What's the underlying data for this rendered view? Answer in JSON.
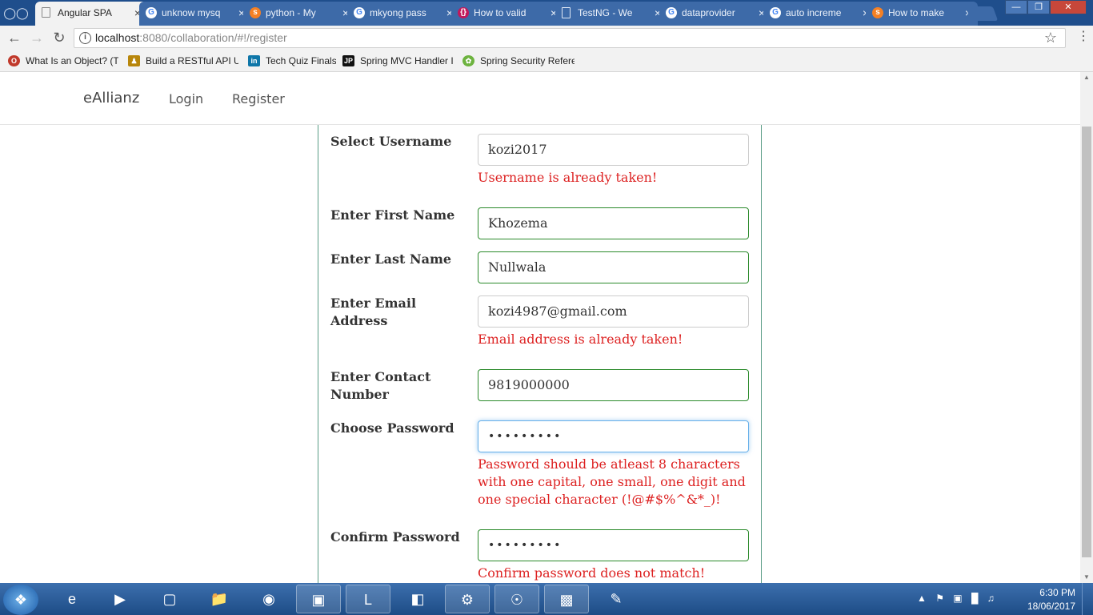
{
  "browser": {
    "tabs": [
      {
        "title": "Angular SPA",
        "favicon": "page-icon",
        "active": true
      },
      {
        "title": "unknow mysql",
        "favicon": "google-icon",
        "active": false
      },
      {
        "title": "python - My",
        "favicon": "stackoverflow-icon",
        "active": false
      },
      {
        "title": "mkyong pass",
        "favicon": "google-icon",
        "active": false
      },
      {
        "title": "How to valid",
        "favicon": "puzzle-icon",
        "active": false
      },
      {
        "title": "TestNG - We",
        "favicon": "page-icon",
        "active": false
      },
      {
        "title": "dataprovider",
        "favicon": "google-icon",
        "active": false
      },
      {
        "title": "auto increme",
        "favicon": "google-icon",
        "active": false
      },
      {
        "title": "How to make",
        "favicon": "stackoverflow-icon",
        "active": false
      }
    ],
    "url_host": "localhost",
    "url_rest": ":8080/collaboration/#!/register",
    "bookmarks": [
      {
        "label": "What Is an Object? (Th",
        "icon": "oracle-icon",
        "color": "#c0392b"
      },
      {
        "label": "Build a RESTful API Us",
        "icon": "person-icon",
        "color": "#b8860b"
      },
      {
        "label": "Tech Quiz Finals",
        "icon": "linkedin-icon",
        "color": "#0e76a8",
        "glyph": "in"
      },
      {
        "label": "Spring MVC Handler I",
        "icon": "jp-icon",
        "color": "#111111",
        "glyph": "JP"
      },
      {
        "label": "Spring Security Refere",
        "icon": "spring-leaf-icon",
        "color": "#6db33f"
      }
    ]
  },
  "navbar": {
    "brand": "eAllianz",
    "links": [
      "Login",
      "Register"
    ]
  },
  "form": {
    "username": {
      "label": "Select Username",
      "value": "kozi2017",
      "error": "Username is already taken!"
    },
    "first_name": {
      "label": "Enter First Name",
      "value": "Khozema"
    },
    "last_name": {
      "label": "Enter Last Name",
      "value": "Nullwala"
    },
    "email": {
      "label": "Enter Email Address",
      "value": "kozi4987@gmail.com",
      "error": "Email address is already taken!"
    },
    "contact": {
      "label": "Enter Contact Number",
      "value": "9819000000"
    },
    "password": {
      "label": "Choose Password",
      "value": "•••••••••",
      "error": "Password should be atleast 8 characters with one capital, one small, one digit and one special character (!@#$%^&*_)!"
    },
    "confirm_password": {
      "label": "Confirm Password",
      "value": "•••••••••",
      "error": "Confirm password does not match!"
    }
  },
  "taskbar": {
    "time": "6:30 PM",
    "date": "18/06/2017",
    "apps": [
      "internet-explorer-icon",
      "media-player-icon",
      "window-icon",
      "file-explorer-icon",
      "firefox-icon",
      "remote-desktop-icon",
      "lync-icon",
      "sticky-notes-icon",
      "java-ee-ide-icon",
      "chrome-icon",
      "mysql-icon",
      "paint-icon"
    ]
  },
  "colors": {
    "error": "#dd2222",
    "valid_border": "#2b8a2b",
    "focus_border": "#66afe9",
    "tabstrip": "#1f4e8c"
  }
}
